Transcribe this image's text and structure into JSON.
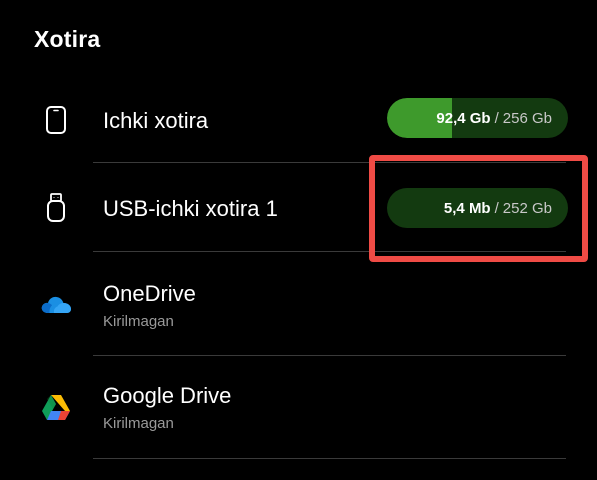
{
  "header": {
    "title": "Xotira"
  },
  "storage": [
    {
      "title": "Ichki xotira",
      "icon": "phone-icon",
      "used": "92,4 Gb",
      "separator": "/",
      "total": "256 Gb",
      "used_fraction": 0.361
    },
    {
      "title": "USB-ichki xotira 1",
      "icon": "usb-drive-icon",
      "used": "5,4 Mb",
      "separator": "/",
      "total": "252 Gb",
      "used_fraction": 2e-05
    }
  ],
  "cloud": [
    {
      "title": "OneDrive",
      "subtitle": "Kirilmagan",
      "icon": "onedrive-icon"
    },
    {
      "title": "Google Drive",
      "subtitle": "Kirilmagan",
      "icon": "google-drive-icon"
    }
  ],
  "colors": {
    "background": "#000000",
    "pill_bg": "#133a10",
    "pill_fill": "#3e9a2c",
    "highlight": "#ef4b45"
  }
}
